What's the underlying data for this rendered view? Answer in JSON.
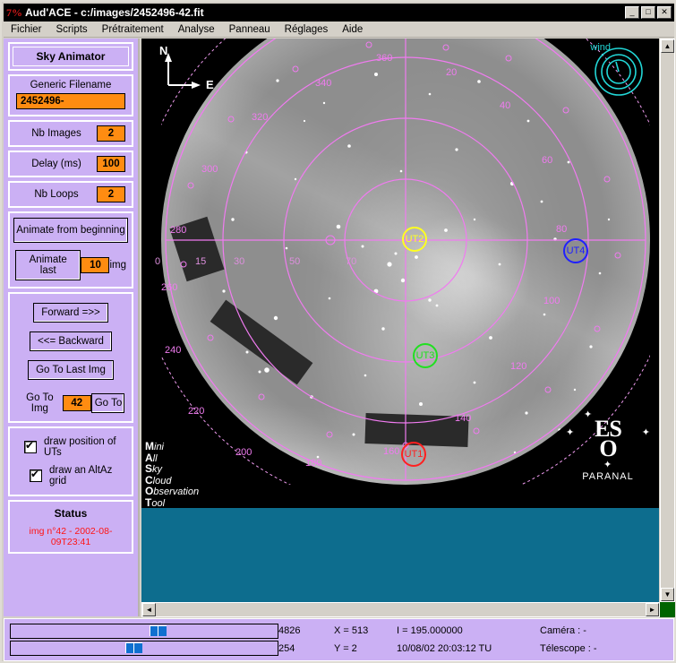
{
  "window": {
    "icon": "aud-ace-logo-icon",
    "title": "Aud'ACE - c:/images/2452496-42.fit",
    "minimize": "–",
    "maximize": "□",
    "close": "✕"
  },
  "menu": {
    "items": [
      {
        "label": "Fichier"
      },
      {
        "label": "Scripts"
      },
      {
        "label": "Prétraitement"
      },
      {
        "label": "Analyse"
      },
      {
        "label": "Panneau"
      },
      {
        "label": "Réglages"
      },
      {
        "label": "Aide"
      }
    ]
  },
  "sidebar": {
    "header": "Sky Animator",
    "generic_filename_label": "Generic Filename",
    "generic_filename_value": "2452496-",
    "nb_images_label": "Nb Images",
    "nb_images_value": "2",
    "delay_label": "Delay (ms)",
    "delay_value": "100",
    "nb_loops_label": "Nb Loops",
    "nb_loops_value": "2",
    "animate_from_beginning": "Animate from beginning",
    "animate_last": "Animate last",
    "animate_last_value": "10",
    "animate_last_unit": "img",
    "forward": "Forward =>>",
    "backward": "<<= Backward",
    "go_to_last_img": "Go To Last Img",
    "go_to_img_label": "Go To Img",
    "go_to_img_value": "42",
    "go_to_button": "Go To",
    "checkbox_uts": "draw position of UTs",
    "checkbox_grid": "draw an AltAz grid",
    "status_header": "Status",
    "status_value": "img n°42 - 2002-08-09T23:41"
  },
  "image": {
    "wind_label": "wind",
    "compass_north": "N",
    "compass_east": "E",
    "observatory": "PARANAL",
    "eso_line1": "ES",
    "eso_line2": "O",
    "mascot": [
      {
        "cap": "M",
        "rest": "ini"
      },
      {
        "cap": "A",
        "rest": "ll"
      },
      {
        "cap": "S",
        "rest": "ky"
      },
      {
        "cap": "C",
        "rest": "loud"
      },
      {
        "cap": "O",
        "rest": "bservation"
      },
      {
        "cap": "T",
        "rest": "ool"
      }
    ],
    "azimuth_labels": [
      "0",
      "15",
      "30",
      "50",
      "70",
      "20",
      "40",
      "60",
      "80",
      "100",
      "120",
      "140",
      "160",
      "180",
      "200",
      "220",
      "240",
      "260",
      "280",
      "300",
      "320",
      "340",
      "360"
    ],
    "telescopes": [
      {
        "name": "UT1",
        "color": "#ff2020"
      },
      {
        "name": "UT2",
        "color": "#ffff20"
      },
      {
        "name": "UT3",
        "color": "#20e020"
      },
      {
        "name": "UT4",
        "color": "#2020ff"
      }
    ],
    "grid_color": "#f07bf0"
  },
  "scrollbars": {
    "up": "▲",
    "down": "▼",
    "left": "◄",
    "right": "►"
  },
  "statusbar": {
    "value_top": "4826",
    "value_bottom": "254",
    "x_coord": "X = 513",
    "y_coord": "Y = 2",
    "intensity": "I = 195.000000",
    "datetime": "10/08/02 20:03:12 TU",
    "camera": "Caméra : -",
    "telescope": "Télescope : -"
  }
}
